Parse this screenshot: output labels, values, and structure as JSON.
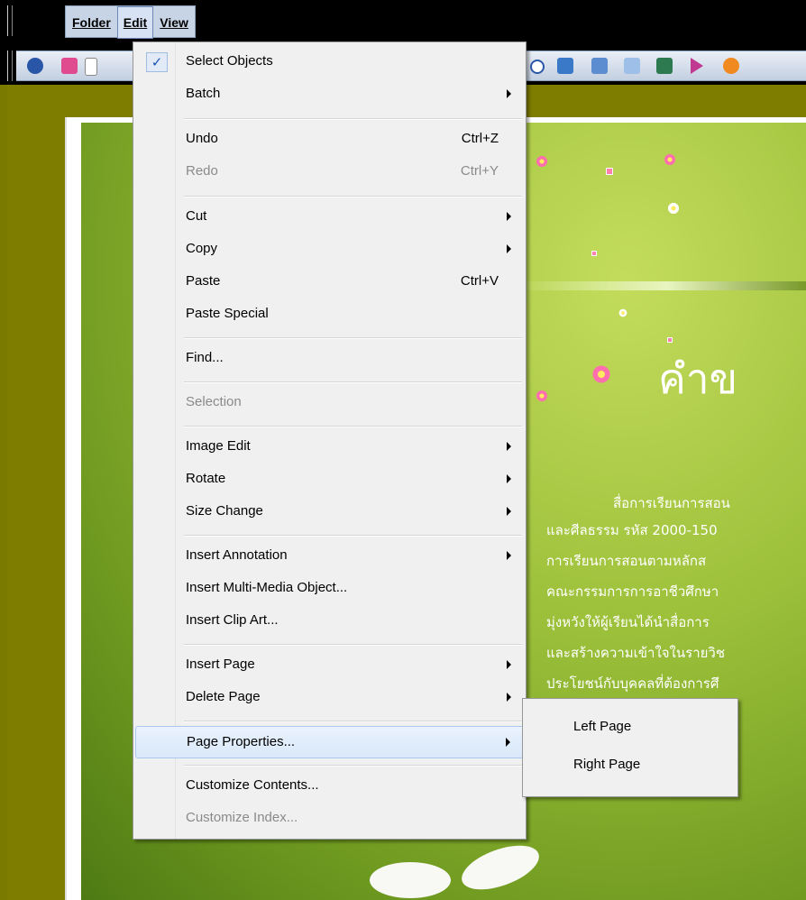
{
  "menubar": {
    "items": [
      "Folder",
      "Edit",
      "View"
    ],
    "active": "Edit"
  },
  "toolbar": {
    "icons": [
      "arrow-icon",
      "page-pink-icon",
      "page-white-icon",
      "play-icon",
      "swap-icon",
      "image-icon",
      "textbox-icon",
      "chart-icon",
      "pointer-icon",
      "flower-icon"
    ]
  },
  "page": {
    "heading": "คำข",
    "lines": [
      "สื่อการเรียนการสอน",
      "และศีลธรรม รหัส 2000-150",
      "การเรียนการสอนตามหลักส",
      "คณะกรรมการการอาชีวศึกษา ",
      "มุ่งหวังให้ผู้เรียนได้นำสื่อการ",
      "และสร้างความเข้าใจในรายวิช",
      "ประโยชน์กับบุคคลที่ต้องการศึ"
    ]
  },
  "edit_menu": {
    "items": [
      {
        "label": "Select Objects",
        "checked": true
      },
      {
        "label": "Batch",
        "submenu": true
      },
      {
        "label": "Undo",
        "shortcut": "Ctrl+Z"
      },
      {
        "label": "Redo",
        "shortcut": "Ctrl+Y",
        "disabled": true
      },
      {
        "label": "Cut",
        "submenu": true
      },
      {
        "label": "Copy",
        "submenu": true
      },
      {
        "label": "Paste",
        "shortcut": "Ctrl+V"
      },
      {
        "label": "Paste Special"
      },
      {
        "label": "Find..."
      },
      {
        "label": "Selection",
        "disabled": true
      },
      {
        "label": "Image Edit",
        "submenu": true
      },
      {
        "label": "Rotate",
        "submenu": true
      },
      {
        "label": "Size Change",
        "submenu": true
      },
      {
        "label": "Insert Annotation",
        "submenu": true
      },
      {
        "label": "Insert Multi-Media Object..."
      },
      {
        "label": "Insert Clip Art..."
      },
      {
        "label": "Insert Page",
        "submenu": true
      },
      {
        "label": "Delete Page",
        "submenu": true
      },
      {
        "label": "Page Properties...",
        "submenu": true,
        "highlighted": true
      },
      {
        "label": "Customize Contents..."
      },
      {
        "label": "Customize Index...",
        "disabled": true
      }
    ]
  },
  "submenu": {
    "items": [
      "Left Page",
      "Right Page"
    ]
  },
  "colors": {
    "menu_bg": "#f0f0f0",
    "highlight": "#d9e8fa",
    "background": "#7a7a00"
  }
}
